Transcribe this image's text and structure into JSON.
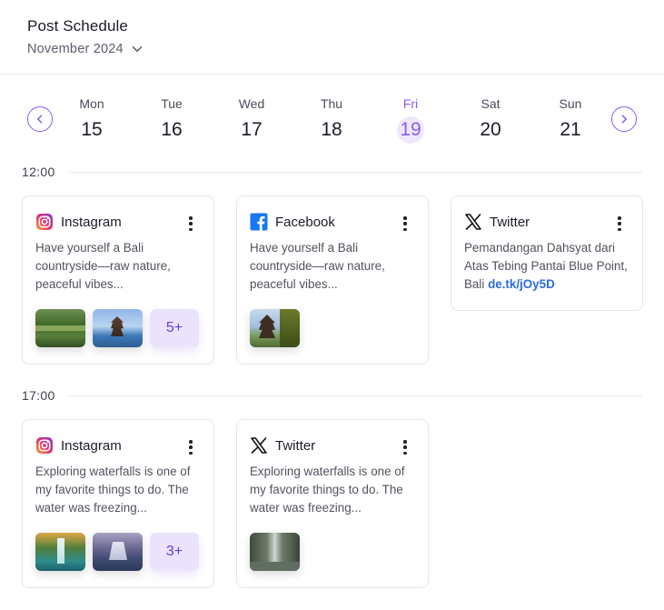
{
  "header": {
    "title": "Post Schedule",
    "month": "November 2024"
  },
  "week": {
    "days": [
      {
        "name": "Mon",
        "num": "15"
      },
      {
        "name": "Tue",
        "num": "16"
      },
      {
        "name": "Wed",
        "num": "17"
      },
      {
        "name": "Thu",
        "num": "18"
      },
      {
        "name": "Fri",
        "num": "19"
      },
      {
        "name": "Sat",
        "num": "20"
      },
      {
        "name": "Sun",
        "num": "21"
      }
    ],
    "selected_day": "19"
  },
  "icons": {
    "prev": "chevron-left-icon",
    "next": "chevron-right-icon",
    "month": "chevron-down-icon",
    "menu": "more-vertical-icon",
    "instagram": "instagram-icon",
    "facebook": "facebook-icon",
    "twitter": "x-twitter-icon"
  },
  "colors": {
    "accent": "#8a5cf0",
    "accent_bg": "#efe8fd",
    "link": "#2b6bdc",
    "facebook": "#1877f2"
  },
  "slots": [
    {
      "time": "12:00",
      "posts": [
        {
          "platform": "Instagram",
          "text": "Have yourself a Bali countryside—raw nature, peaceful vibes...",
          "more": "5+"
        },
        {
          "platform": "Facebook",
          "text": "Have yourself a Bali countryside—raw nature, peaceful vibes..."
        },
        {
          "platform": "Twitter",
          "text": "Pemandangan Dahsyat dari Atas Tebing Pantai Blue Point, Bali ",
          "link": "de.tk/jOy5D"
        }
      ]
    },
    {
      "time": "17:00",
      "posts": [
        {
          "platform": "Instagram",
          "text": "Exploring waterfalls is one of my favorite things to do. The water was freezing...",
          "more": "3+"
        },
        {
          "platform": "Twitter",
          "text": "Exploring waterfalls is one of my favorite things to do. The water was freezing..."
        }
      ]
    }
  ]
}
